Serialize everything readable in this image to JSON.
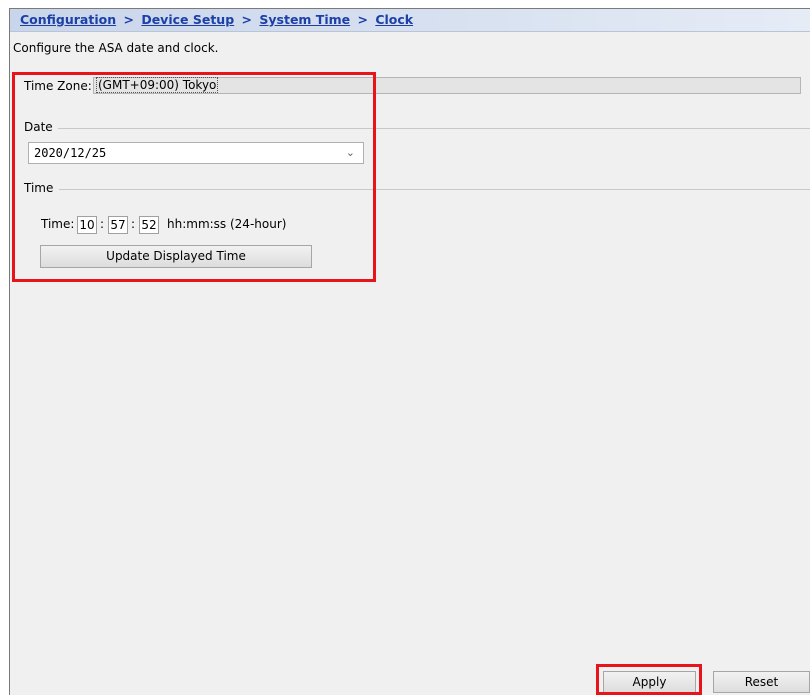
{
  "breadcrumb": {
    "items": [
      "Configuration",
      "Device Setup",
      "System Time",
      "Clock"
    ],
    "separator": ">"
  },
  "description": "Configure the ASA date and clock.",
  "time_zone": {
    "label": "Time Zone:",
    "value": "(GMT+09:00) Tokyo"
  },
  "date_group": {
    "title": "Date",
    "selected_date": "2020/12/25"
  },
  "time_group": {
    "title": "Time",
    "label": "Time:",
    "hours": "10",
    "minutes": "57",
    "seconds": "52",
    "colon": ":",
    "format_hint": "hh:mm:ss (24-hour)",
    "update_button": "Update Displayed Time"
  },
  "footer": {
    "apply_button": "Apply",
    "reset_button": "Reset"
  },
  "colors": {
    "highlight": "#e8141b",
    "link": "#1c3fa8",
    "panel_bg": "#f0f0f0"
  }
}
